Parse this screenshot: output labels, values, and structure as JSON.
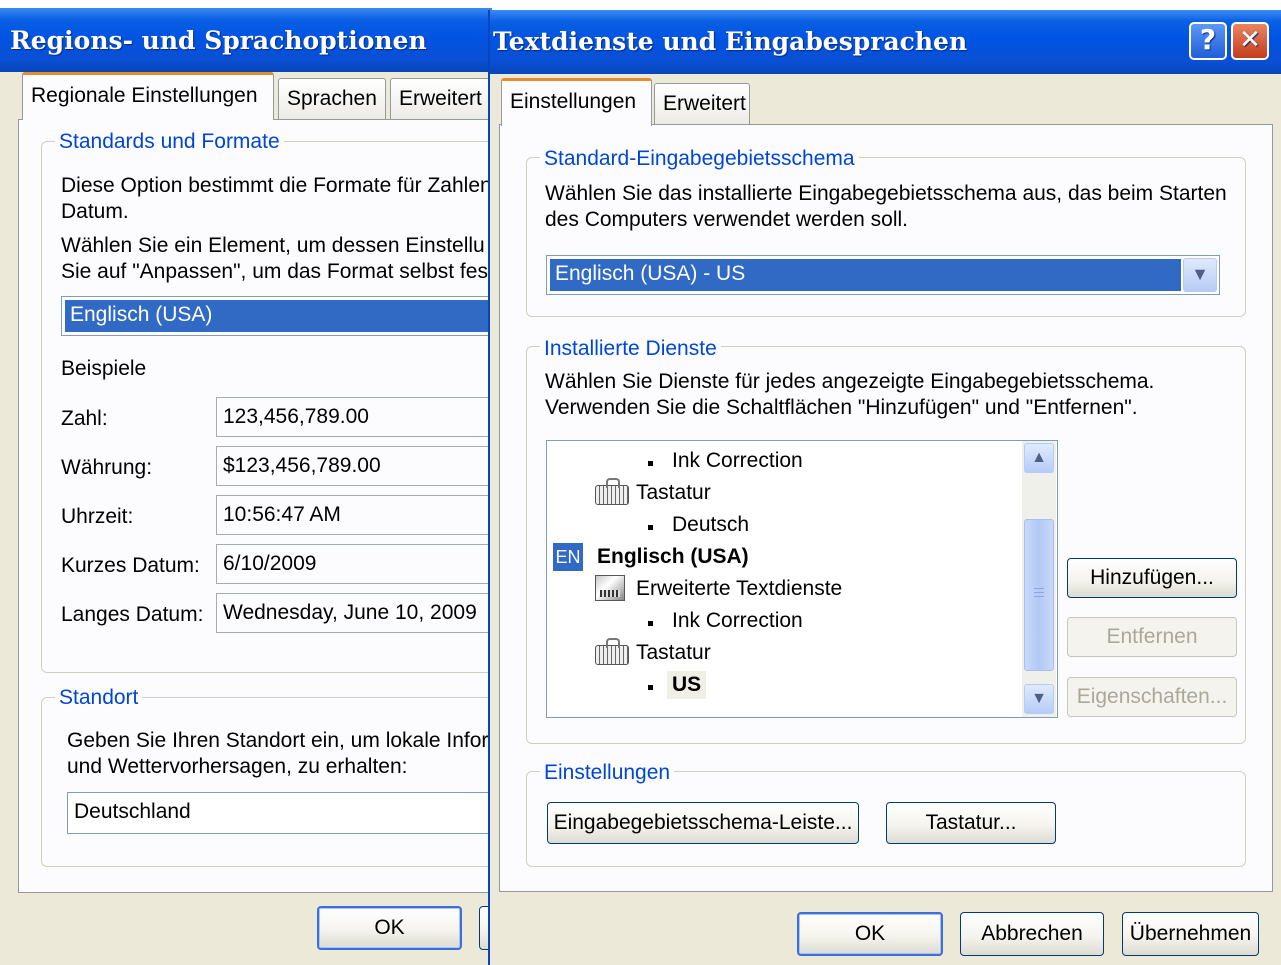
{
  "left_window": {
    "title": "Regions- und Sprachoptionen",
    "tabs": [
      "Regionale Einstellungen",
      "Sprachen",
      "Erweitert"
    ],
    "standards_group": {
      "label": "Standards und Formate",
      "desc_line1": "Diese Option bestimmt die Formate für Zahlen",
      "desc_line2": "Datum.",
      "choose_line1": "Wählen Sie ein Element, um dessen Einstellu",
      "choose_line2": "Sie auf \"Anpassen\", um das Format selbst fes",
      "selected_format": "Englisch (USA)",
      "examples_label": "Beispiele",
      "examples": [
        {
          "label": "Zahl:",
          "value": "123,456,789.00"
        },
        {
          "label": "Währung:",
          "value": "$123,456,789.00"
        },
        {
          "label": "Uhrzeit:",
          "value": "10:56:47 AM"
        },
        {
          "label": "Kurzes Datum:",
          "value": "6/10/2009"
        },
        {
          "label": "Langes Datum:",
          "value": "Wednesday, June 10, 2009"
        }
      ]
    },
    "location_group": {
      "label": "Standort",
      "desc_line1": "Geben Sie Ihren Standort ein, um lokale Infor",
      "desc_line2": "und Wettervorhersagen, zu erhalten:",
      "value": "Deutschland"
    },
    "ok_label": "OK"
  },
  "right_window": {
    "title": "Textdienste und Eingabesprachen",
    "help_glyph": "?",
    "close_glyph": "✕",
    "tabs": [
      "Einstellungen",
      "Erweitert"
    ],
    "default_group": {
      "label": "Standard-Eingabegebietsschema",
      "desc_line1": "Wählen Sie das installierte Eingabegebietsschema aus, das beim Starten",
      "desc_line2": "des Computers verwendet werden soll.",
      "selected": "Englisch (USA) - US"
    },
    "installed_group": {
      "label": "Installierte Dienste",
      "desc_line1": "Wählen Sie Dienste für jedes angezeigte Eingabegebietsschema.",
      "desc_line2": "Verwenden Sie die Schaltflächen \"Hinzufügen\" und \"Entfernen\".",
      "tree": {
        "item_ink1": "Ink Correction",
        "item_kbd1": "Tastatur",
        "item_deutsch": "Deutsch",
        "lang_badge": "EN",
        "item_lang": "Englisch (USA)",
        "item_ext": "Erweiterte Textdienste",
        "item_ink2": "Ink Correction",
        "item_kbd2": "Tastatur",
        "item_us": "US"
      },
      "add_label": "Hinzufügen...",
      "remove_label": "Entfernen",
      "properties_label": "Eigenschaften..."
    },
    "settings_group": {
      "label": "Einstellungen",
      "langbar_label": "Eingabegebietsschema-Leiste...",
      "keyboard_label": "Tastatur..."
    },
    "ok_label": "OK",
    "cancel_label": "Abbrechen",
    "apply_label": "Übernehmen"
  }
}
